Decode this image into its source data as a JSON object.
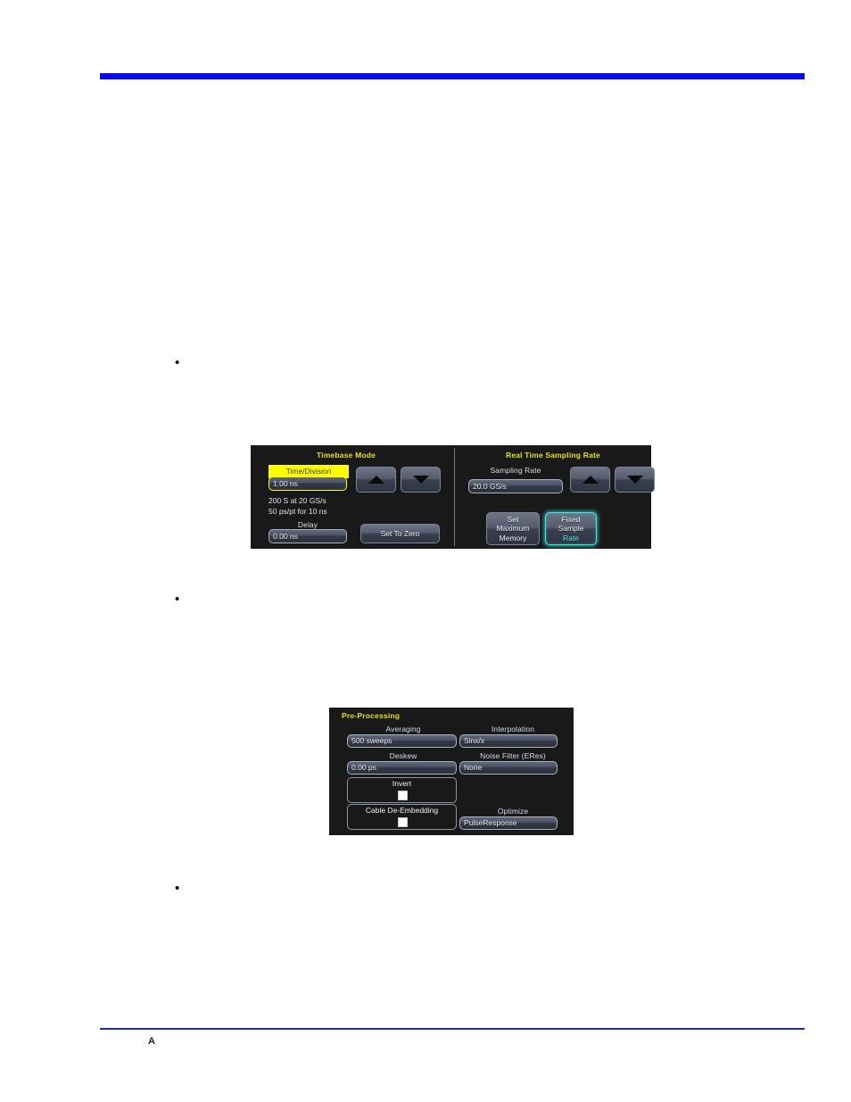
{
  "page": {
    "folio": "A",
    "bullets": [
      {
        "marker": "•",
        "text": ""
      },
      {
        "marker": "•",
        "text": ""
      },
      {
        "marker": "•",
        "text": ""
      }
    ]
  },
  "colors": {
    "rule_top": "#0a0ae8",
    "rule_bottom": "#1a2ea8",
    "panel_background": "#191919",
    "panel_title": "#e2e21c",
    "selected_accent": "#3ee8e8",
    "highlight_field": "#ffff00"
  },
  "timebase_dialog": {
    "left_panel": {
      "title": "Timebase Mode",
      "time_division": {
        "label": "Time/Division",
        "value": "1.00 ns",
        "highlighted": true
      },
      "increase_icon": "triangle-up-icon",
      "decrease_icon": "triangle-down-icon",
      "info_text": "200 S at 20 GS/s\n50 ps/pt for 10 ns",
      "delay": {
        "label": "Delay",
        "value": "0.00 ns"
      },
      "set_to_zero_label": "Set To Zero"
    },
    "right_panel": {
      "title": "Real Time Sampling Rate",
      "sampling_rate": {
        "label": "Sampling Rate",
        "value": "20.0 GS/s"
      },
      "increase_icon": "triangle-up-icon",
      "decrease_icon": "triangle-down-icon",
      "set_maximum_memory_label": "Set\nMaximum\nMemory",
      "fixed_sample_rate": {
        "line1": "Fixed",
        "line2": "Sample",
        "line3": "Rate",
        "selected": true
      }
    }
  },
  "preprocessing_dialog": {
    "title": "Pre-Processing",
    "averaging": {
      "label": "Averaging",
      "value": "500 sweeps"
    },
    "deskew": {
      "label": "Deskew",
      "value": "0.00 ps"
    },
    "invert": {
      "label": "Invert",
      "checked": false
    },
    "cable_de_embedding": {
      "label": "Cable De-Embedding",
      "checked": false
    },
    "interpolation": {
      "label": "Interpolation",
      "value": "Sinx/x"
    },
    "noise_filter": {
      "label": "Noise Filter (ERes)",
      "value": "None"
    },
    "optimize": {
      "label": "Optimize",
      "value": "PulseResponse"
    }
  }
}
